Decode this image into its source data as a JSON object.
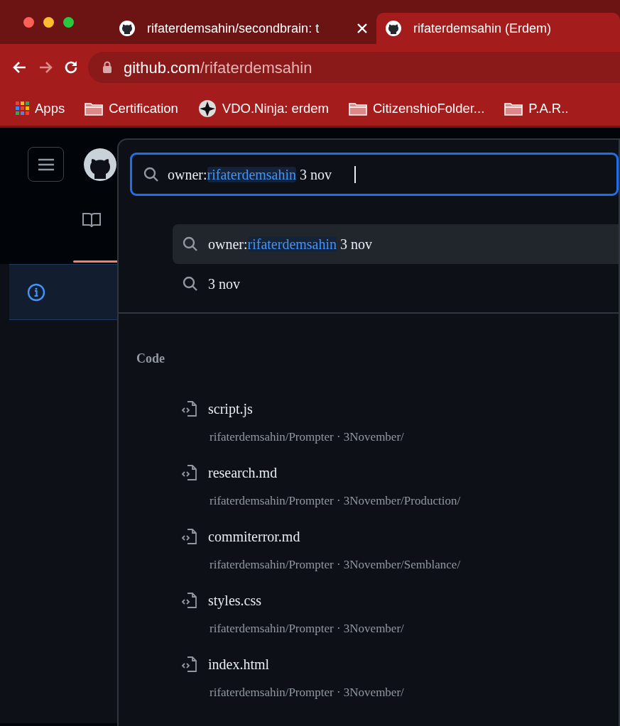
{
  "browser": {
    "tabs": [
      {
        "title": "rifaterdemsahin/secondbrain: t",
        "selected": false,
        "closable": true
      },
      {
        "title": "rifaterdemsahin (Erdem)",
        "selected": true,
        "closable": false
      }
    ],
    "nav": [
      {
        "kind": "back",
        "disabled": false
      },
      {
        "kind": "forward",
        "disabled": true
      },
      {
        "kind": "reload",
        "disabled": false
      }
    ],
    "address": {
      "host": "github.com",
      "path": "/rifaterdemsahin"
    },
    "bookmarks": [
      {
        "kind": "apps",
        "label": "Apps"
      },
      {
        "kind": "folder",
        "label": "Certification"
      },
      {
        "kind": "site",
        "label": "VDO.Ninja: erdem"
      },
      {
        "kind": "folder",
        "label": "CitizenshioFolder..."
      },
      {
        "kind": "folder",
        "label": "P.A.R.."
      }
    ]
  },
  "search": {
    "query": {
      "qualifier": "owner:",
      "value": "rifaterdemsahin",
      "rest": " 3 nov"
    },
    "suggestions": [
      {
        "qualifier": "owner:",
        "value": "rifaterdemsahin",
        "rest": " 3 nov",
        "selected": true
      },
      {
        "rest": "3 nov",
        "selected": false
      }
    ],
    "section_title": "Code",
    "results": [
      {
        "name": "script.js",
        "path": "rifaterdemsahin/Prompter · 3November/"
      },
      {
        "name": "research.md",
        "path": "rifaterdemsahin/Prompter · 3November/Production/"
      },
      {
        "name": "commiterror.md",
        "path": "rifaterdemsahin/Prompter · 3November/Semblance/"
      },
      {
        "name": "styles.css",
        "path": "rifaterdemsahin/Prompter · 3November/"
      },
      {
        "name": "index.html",
        "path": "rifaterdemsahin/Prompter · 3November/"
      }
    ]
  }
}
